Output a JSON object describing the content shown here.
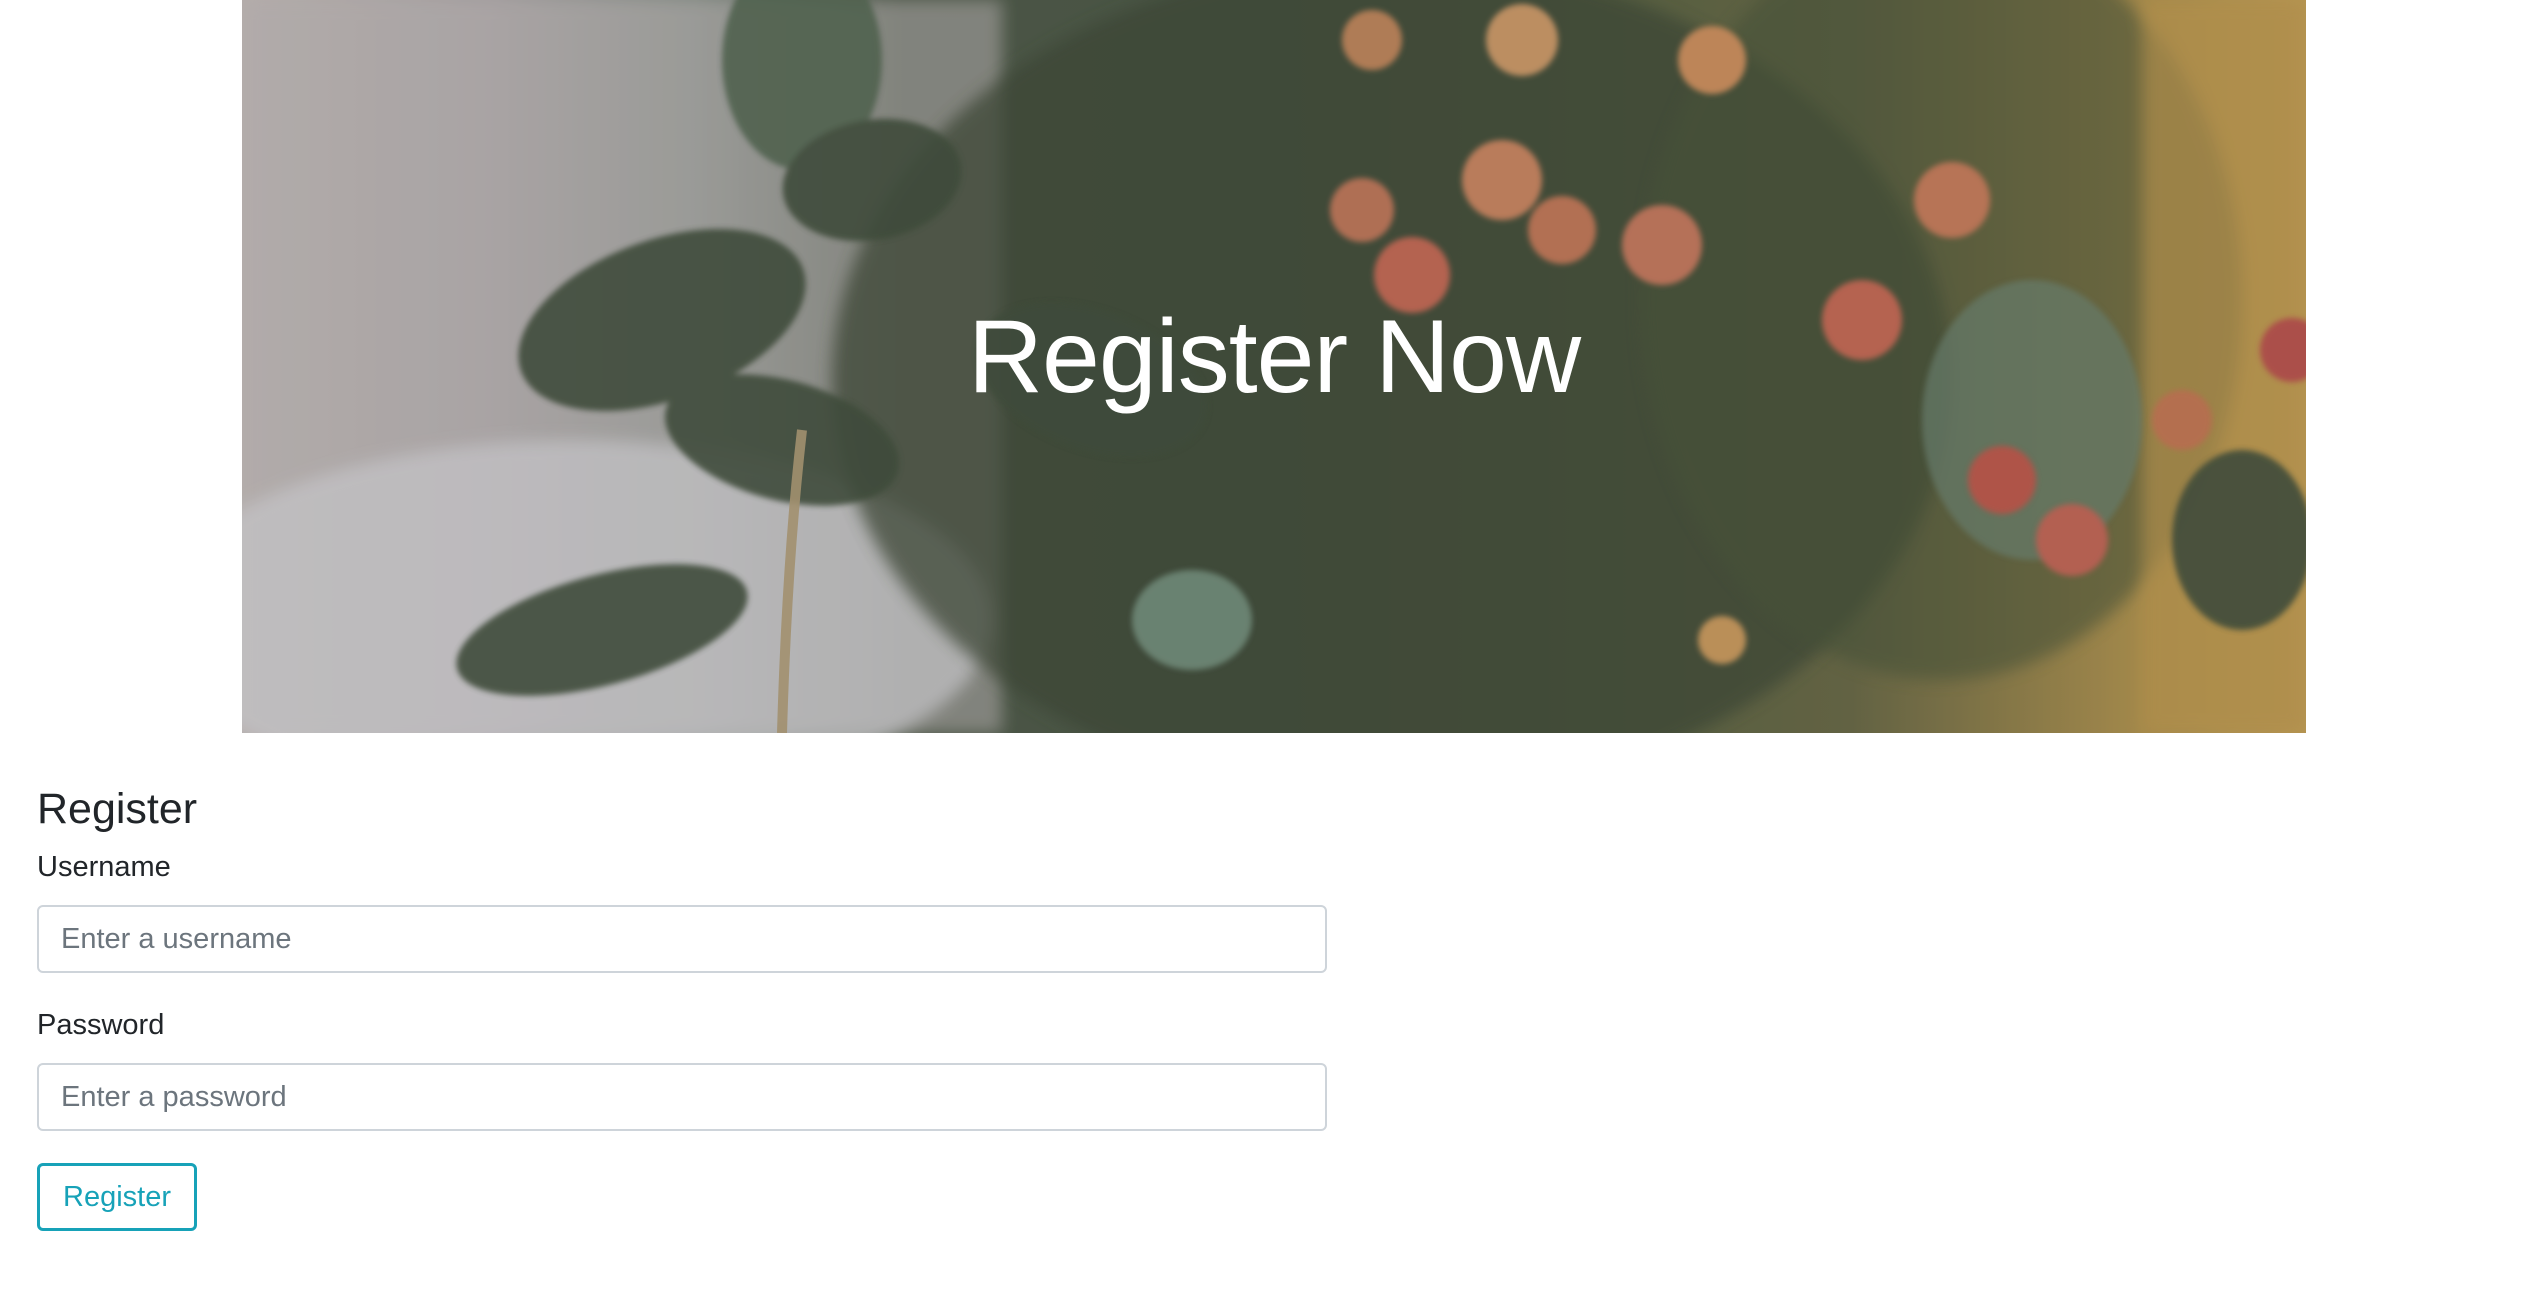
{
  "hero": {
    "title": "Register Now"
  },
  "form": {
    "heading": "Register",
    "username": {
      "label": "Username",
      "placeholder": "Enter a username",
      "value": ""
    },
    "password": {
      "label": "Password",
      "placeholder": "Enter a password",
      "value": ""
    },
    "submit_label": "Register"
  },
  "colors": {
    "accent": "#17a2b8",
    "text": "#212529",
    "input_border": "#ced4da"
  }
}
